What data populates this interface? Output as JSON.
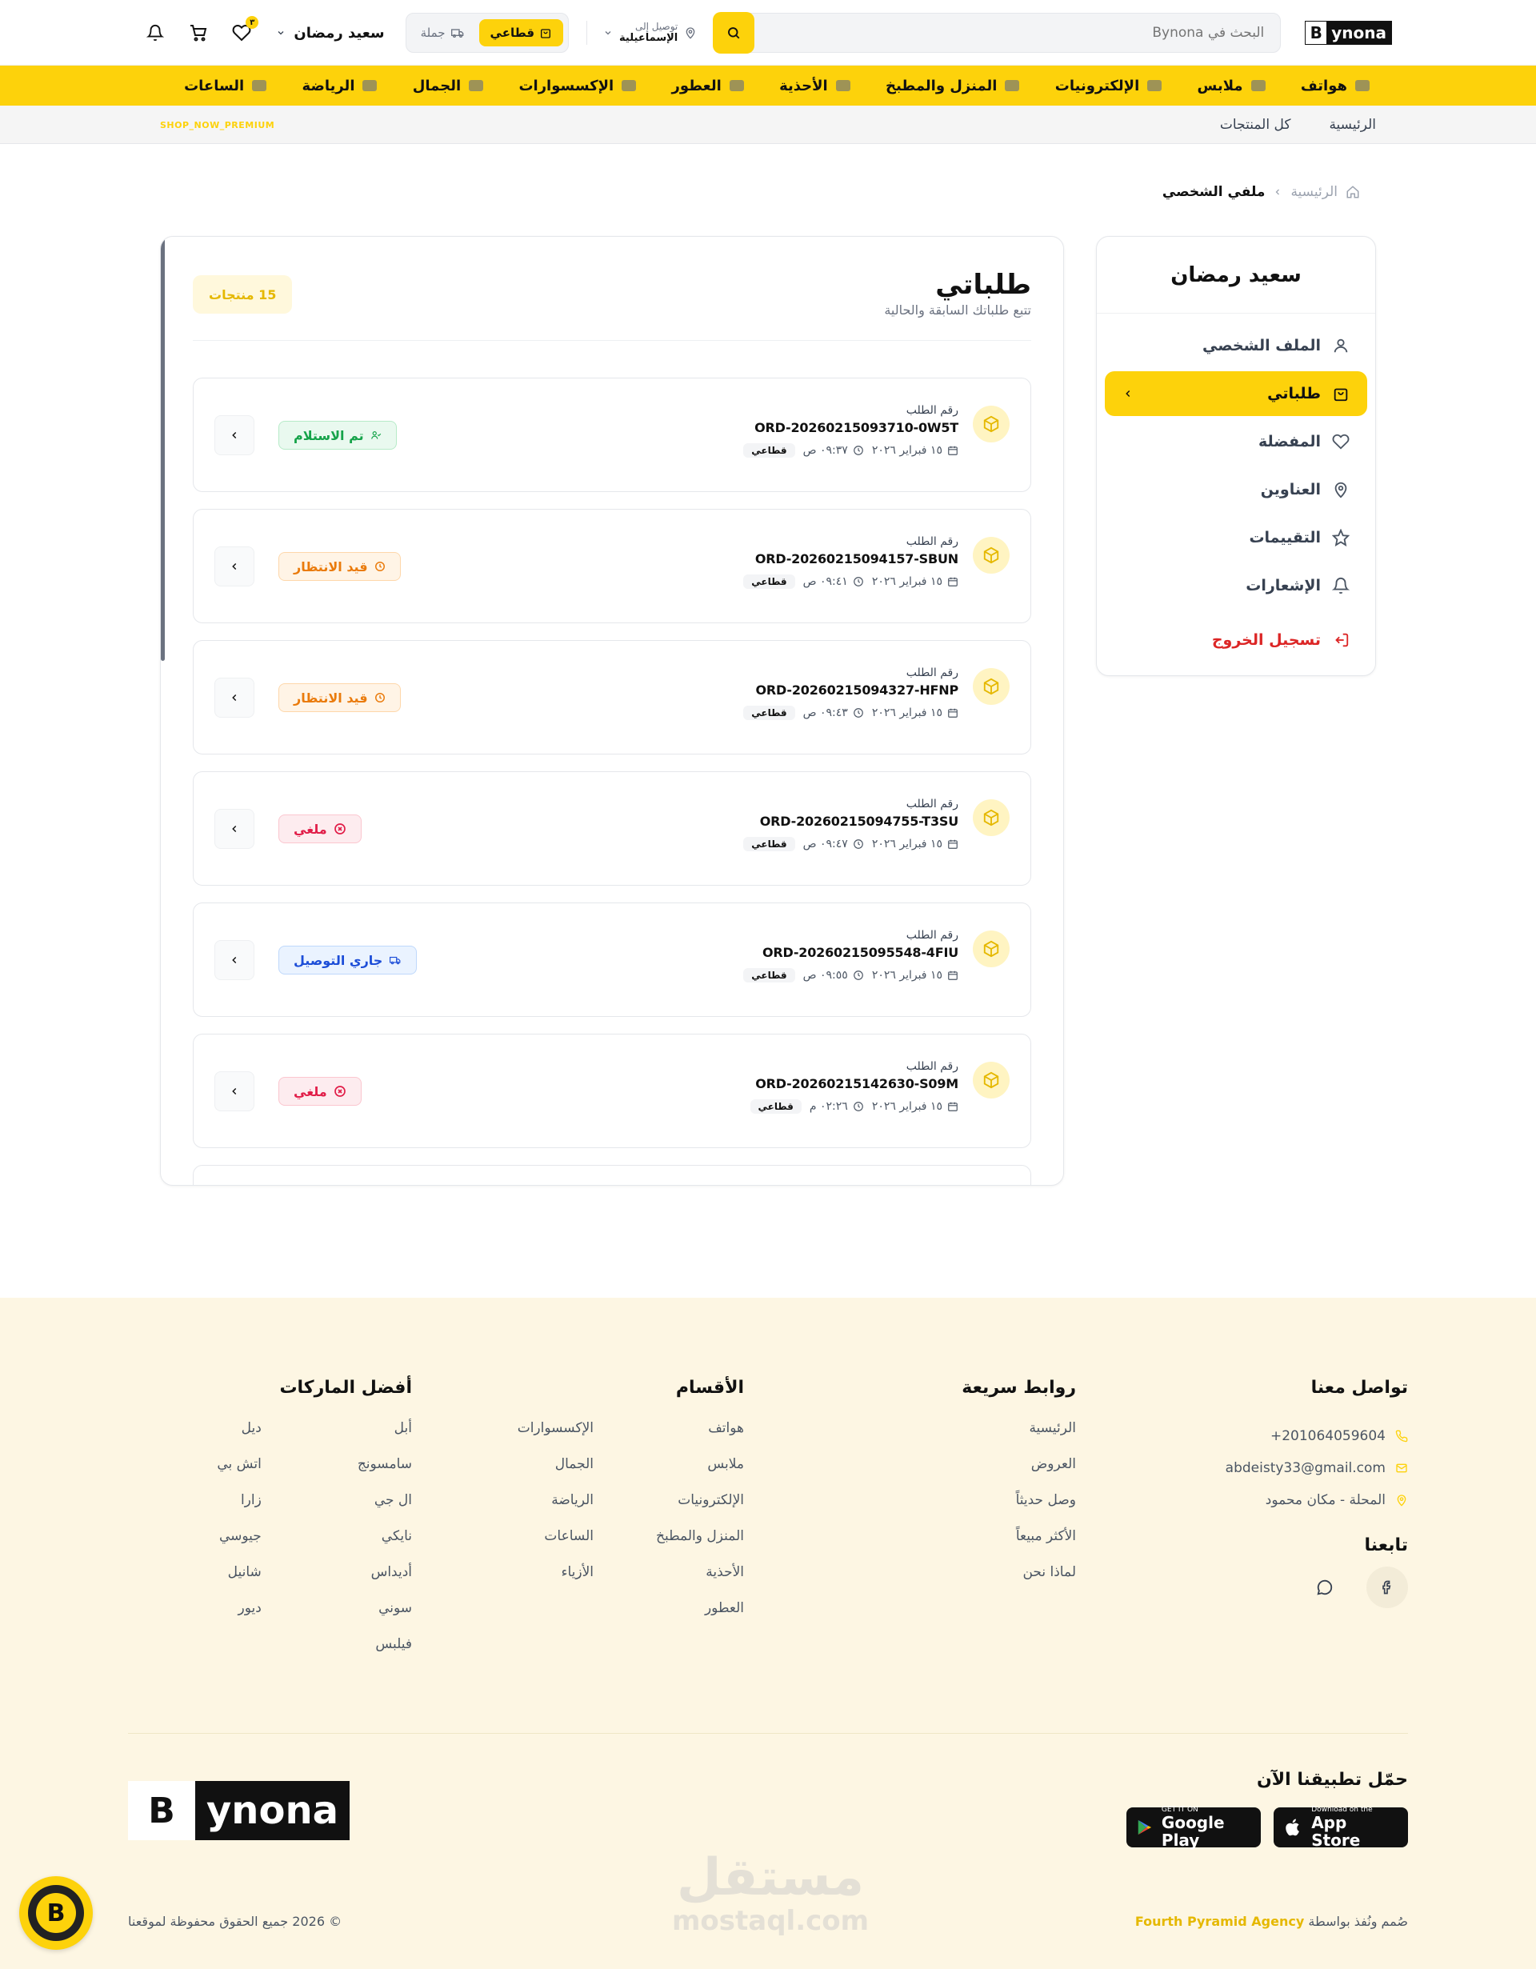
{
  "header": {
    "logo_b": "B",
    "logo_rest": "ynona",
    "search_placeholder": "البحث في Bynona",
    "deliver_label": "توصيل إلى",
    "deliver_city": "الإسماعيلية",
    "mode_retail": "قطاعي",
    "mode_wholesale": "جملة",
    "user_name": "سعيد رمضان",
    "wishlist_badge": "٣"
  },
  "categories": [
    {
      "label": "هواتف"
    },
    {
      "label": "ملابس"
    },
    {
      "label": "الإلكترونيات"
    },
    {
      "label": "المنزل والمطبخ"
    },
    {
      "label": "الأحذية"
    },
    {
      "label": "العطور"
    },
    {
      "label": "الإكسسوارات"
    },
    {
      "label": "الجمال"
    },
    {
      "label": "الرياضة"
    },
    {
      "label": "الساعات"
    }
  ],
  "subnav": {
    "home": "الرئيسية",
    "all_products": "كل المنتجات",
    "promo": "SHOP_NOW_PREMIUM"
  },
  "breadcrumb": {
    "home": "الرئيسية",
    "current": "ملفي الشخصي"
  },
  "sidebar": {
    "name": "سعيد رمضان",
    "items": [
      {
        "label": "الملف الشخصي"
      },
      {
        "label": "طلباتي"
      },
      {
        "label": "المفضلة"
      },
      {
        "label": "العناوين"
      },
      {
        "label": "التقييمات"
      },
      {
        "label": "الإشعارات"
      }
    ],
    "logout": "تسجيل الخروج"
  },
  "orders": {
    "title": "طلباتي",
    "subtitle": "تتبع طلباتك السابقة والحالية",
    "count": "15 منتجات",
    "order_label": "رقم الطلب",
    "list": [
      {
        "number": "ORD-20260215093710-0W5T",
        "date": "١٥ فبراير ٢٠٢٦",
        "time": "٠٩:٣٧ ص",
        "type": "قطاعي",
        "status": "تم الاستلام",
        "status_kind": "green"
      },
      {
        "number": "ORD-20260215094157-SBUN",
        "date": "١٥ فبراير ٢٠٢٦",
        "time": "٠٩:٤١ ص",
        "type": "قطاعي",
        "status": "قيد الانتظار",
        "status_kind": "orange"
      },
      {
        "number": "ORD-20260215094327-HFNP",
        "date": "١٥ فبراير ٢٠٢٦",
        "time": "٠٩:٤٣ ص",
        "type": "قطاعي",
        "status": "قيد الانتظار",
        "status_kind": "orange"
      },
      {
        "number": "ORD-20260215094755-T3SU",
        "date": "١٥ فبراير ٢٠٢٦",
        "time": "٠٩:٤٧ ص",
        "type": "قطاعي",
        "status": "ملغي",
        "status_kind": "red"
      },
      {
        "number": "ORD-20260215095548-4FIU",
        "date": "١٥ فبراير ٢٠٢٦",
        "time": "٠٩:٥٥ ص",
        "type": "قطاعي",
        "status": "جاري التوصيل",
        "status_kind": "blue"
      },
      {
        "number": "ORD-20260215142630-S09M",
        "date": "١٥ فبراير ٢٠٢٦",
        "time": "٠٢:٢٦ م",
        "type": "قطاعي",
        "status": "ملغي",
        "status_kind": "red"
      }
    ]
  },
  "footer": {
    "contact_title": "تواصل معنا",
    "phone": "+201064059604",
    "email": "abdeisty33@gmail.com",
    "address": "المحلة - مكان محمود",
    "follow_title": "تابعنا",
    "quick_title": "روابط سريعة",
    "quick": [
      "الرئيسية",
      "العروض",
      "وصل حديثاً",
      "الأكثر مبيعاً",
      "لماذا نحن"
    ],
    "sections_title": "الأقسام",
    "sections_a": [
      "هواتف",
      "ملابس",
      "الإلكترونيات",
      "المنزل والمطبخ",
      "الأحذية",
      "العطور"
    ],
    "sections_b": [
      "الإكسسوارات",
      "الجمال",
      "الرياضة",
      "الساعات",
      "الأزياء"
    ],
    "brands_title": "أفضل الماركات",
    "brands_a": [
      "أبل",
      "سامسونج",
      "ال جي",
      "نايكي",
      "أديداس",
      "سوني",
      "فيلبس"
    ],
    "brands_b": [
      "ديل",
      "اتش بي",
      "زارا",
      "جيوسي",
      "شانيل",
      "ديور"
    ],
    "app_title": "حمّل تطبيقنا الآن",
    "appstore_small": "Download on the",
    "appstore_big": "App Store",
    "play_small": "GET IT ON",
    "play_big": "Google Play",
    "logo_b": "B",
    "logo_rest": "ynona",
    "credit_text": "صُمم ونُفذ بواسطة",
    "agency": "Fourth Pyramid Agency",
    "copyright": "© 2026 جميع الحقوق محفوظة لموقعنا",
    "watermark_ar": "مستقل",
    "watermark_en": "mostaql.com",
    "fab_letter": "B"
  },
  "colors": {
    "brand_yellow": "#fdd20b",
    "danger": "#dc2626",
    "footer_bg": "#fdf6e3"
  }
}
